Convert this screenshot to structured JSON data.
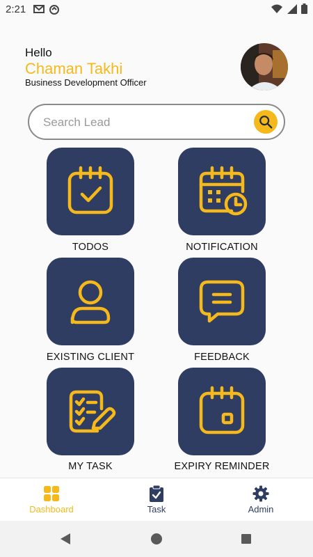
{
  "status_bar": {
    "time": "2:21"
  },
  "header": {
    "greeting": "Hello",
    "user_name": "Chaman Takhi",
    "user_role": "Business Development Officer"
  },
  "search": {
    "placeholder": "Search Lead",
    "value": ""
  },
  "menu_tiles": [
    {
      "label": "TODOS",
      "icon": "calendar-check-icon"
    },
    {
      "label": "NOTIFICATION",
      "icon": "calendar-clock-icon"
    },
    {
      "label": "EXISTING CLIENT",
      "icon": "user-icon"
    },
    {
      "label": "FEEDBACK",
      "icon": "chat-bubble-icon"
    },
    {
      "label": "MY TASK",
      "icon": "task-list-icon"
    },
    {
      "label": "EXPIRY REMINDER",
      "icon": "calendar-icon"
    }
  ],
  "bottom_nav": [
    {
      "label": "Dashboard",
      "icon": "dashboard-grid-icon",
      "active": true
    },
    {
      "label": "Task",
      "icon": "clipboard-check-icon",
      "active": false
    },
    {
      "label": "Admin",
      "icon": "gear-icon",
      "active": false
    }
  ],
  "colors": {
    "accent": "#f6b91b",
    "tile_background": "#2f3d62",
    "page_background": "#fafafa"
  }
}
